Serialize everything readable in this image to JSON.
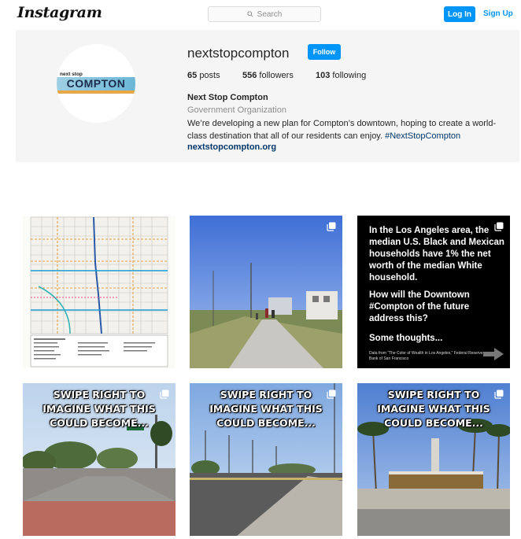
{
  "header": {
    "logo": "Instagram",
    "search_placeholder": "Search",
    "login_label": "Log In",
    "signup_label": "Sign Up"
  },
  "profile": {
    "avatar_small": "next stop",
    "avatar_big": "COMPTON",
    "username": "nextstopcompton",
    "follow_label": "Follow",
    "posts_count": "65",
    "posts_label": "posts",
    "followers_count": "556",
    "followers_label": "followers",
    "following_count": "103",
    "following_label": "following",
    "full_name": "Next Stop Compton",
    "category": "Government Organization",
    "bio": "We’re developing a new plan for Compton’s downtown, hoping to create a world-class destination that all of our residents can enjoy.",
    "bio_hashtag": "#NextStopCompton",
    "website": "nextstopcompton.org"
  },
  "posts": [
    {
      "kind": "map"
    },
    {
      "kind": "photo-path",
      "multi": true
    },
    {
      "kind": "text-card",
      "multi": true,
      "line1": "In the Los Angeles area, the median U.S. Black and Mexican households have 1% the net worth of the median White household.",
      "line2": "How will the Downtown #Compton of the future address this?",
      "line3": "Some thoughts...",
      "source": "Data from “The Color of Wealth in Los Angeles,” Federal Reserve Bank of San Francisco"
    },
    {
      "kind": "swipe",
      "multi": true,
      "caption": [
        "SWIPE RIGHT TO",
        "IMAGINE WHAT THIS",
        "COULD BECOME..."
      ]
    },
    {
      "kind": "swipe",
      "multi": true,
      "caption": [
        "SWIPE RIGHT TO",
        "IMAGINE WHAT THIS",
        "COULD BECOME..."
      ]
    },
    {
      "kind": "swipe",
      "multi": true,
      "caption": [
        "SWIPE RIGHT TO",
        "IMAGINE WHAT THIS",
        "COULD BECOME..."
      ]
    }
  ],
  "colors": {
    "accent": "#0095f6",
    "link": "#00376b",
    "profile_bg": "#f5f5f5"
  }
}
